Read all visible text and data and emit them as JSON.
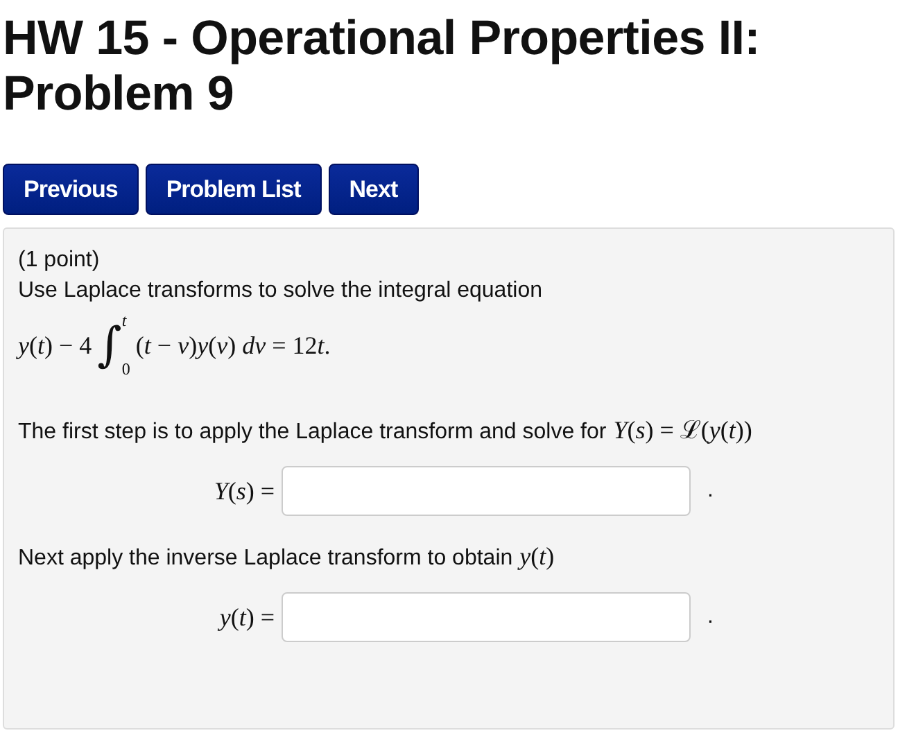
{
  "title": "HW 15 - Operational Properties II: Problem 9",
  "nav_buttons": [
    "Previous",
    "Problem List",
    "Next"
  ],
  "problem": {
    "points": "(1 point)",
    "intro": "Use Laplace transforms to solve the integral equation",
    "equation": {
      "left": "*y*(*t*) − 4",
      "integral": "∫",
      "upper": "t",
      "lower": "0",
      "right": "(*t* − *v*)*y*(*v*) *dv* = 12",
      "right_tail": "*t*."
    },
    "parts": [
      {
        "text": "The first step is to apply the Laplace transform and solve for",
        "math": "*Y*(*s*) = ℒ(*y*(*t*))",
        "answer_label": "*Y*(*s*) =",
        "period": "."
      },
      {
        "text": "Next apply the inverse Laplace transform to obtain",
        "math": "*y*(*t*)",
        "answer_label": "*y*(*t*) =",
        "period": "."
      }
    ]
  }
}
